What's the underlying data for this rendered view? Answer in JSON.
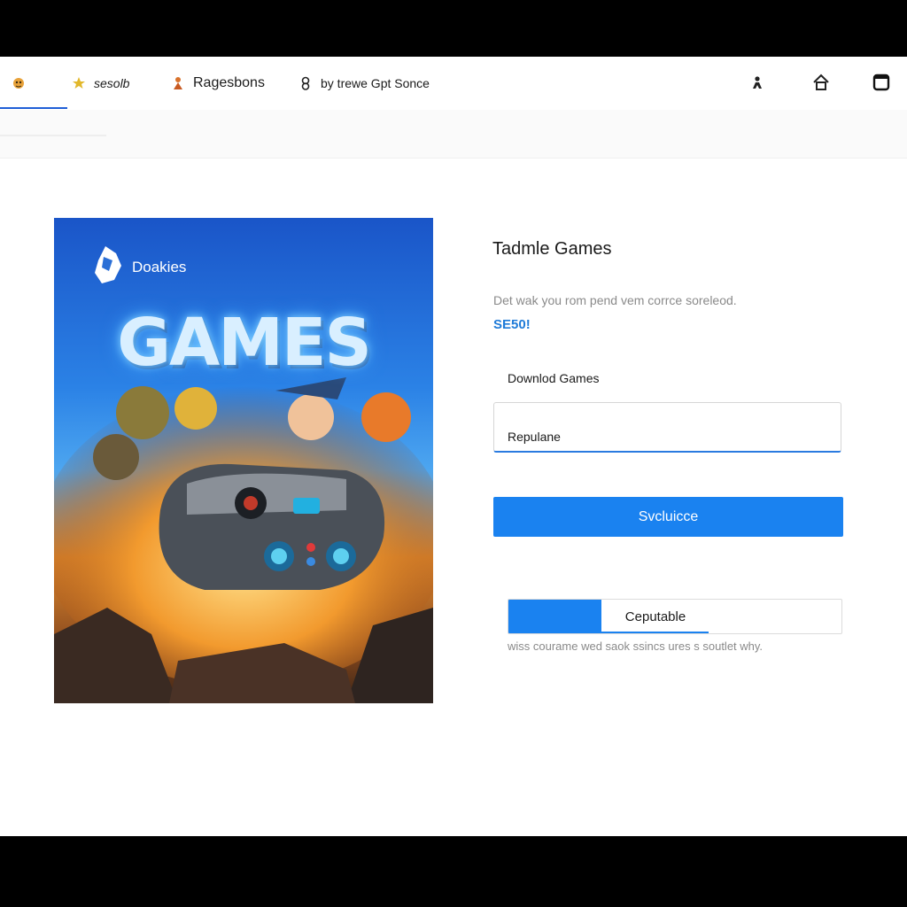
{
  "nav": {
    "tabs": [
      {
        "label": "",
        "icon": "gamepad-icon"
      },
      {
        "label": "sesolb",
        "icon": "star-icon"
      },
      {
        "label": "Ragesbons",
        "icon": "figure-icon"
      },
      {
        "label": "by trewe Gpt Sonce",
        "icon": "link-icon"
      }
    ],
    "tools": [
      "user-icon",
      "home-icon",
      "window-icon"
    ]
  },
  "poster": {
    "brand": "Doakies",
    "title": "GAMES"
  },
  "panel": {
    "title": "Tadmle Games",
    "description": "Det wak you rom pend vem corrce soreleod.",
    "price": "SE50!",
    "field_label": "Downlod Games",
    "field_value": "Repulane",
    "primary_button": "Svcluicce",
    "progress_label": "Ceputable",
    "progress_fraction": 0.28,
    "progress_note": "wiss courame wed saok ssincs ures s soutlet why."
  },
  "colors": {
    "accent": "#1a82f0",
    "price": "#1f7bd8"
  }
}
